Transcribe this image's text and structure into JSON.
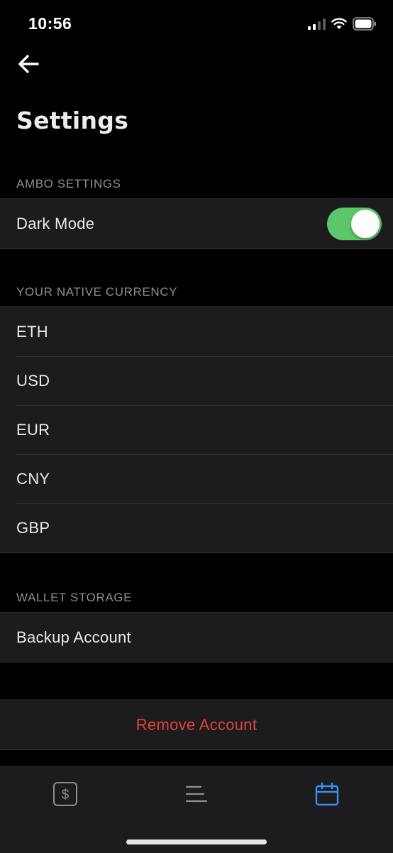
{
  "status_bar": {
    "time": "10:56"
  },
  "header": {
    "title": "Settings"
  },
  "sections": {
    "ambo": {
      "header": "AMBO SETTINGS",
      "dark_mode_label": "Dark Mode",
      "dark_mode_on": true
    },
    "currency": {
      "header": "YOUR NATIVE CURRENCY",
      "items": [
        "ETH",
        "USD",
        "EUR",
        "CNY",
        "GBP"
      ]
    },
    "wallet": {
      "header": "WALLET STORAGE",
      "backup_label": "Backup Account"
    },
    "danger": {
      "remove_label": "Remove Account"
    }
  },
  "tab_bar": {
    "tabs": [
      {
        "icon": "dollar-card-icon",
        "active": false
      },
      {
        "icon": "menu-icon",
        "active": false
      },
      {
        "icon": "calendar-icon",
        "active": true
      }
    ]
  },
  "colors": {
    "toggle_on": "#5bc768",
    "danger": "#e0413a",
    "active_tab": "#3b8ff0",
    "inactive_tab": "#8e8e93"
  }
}
